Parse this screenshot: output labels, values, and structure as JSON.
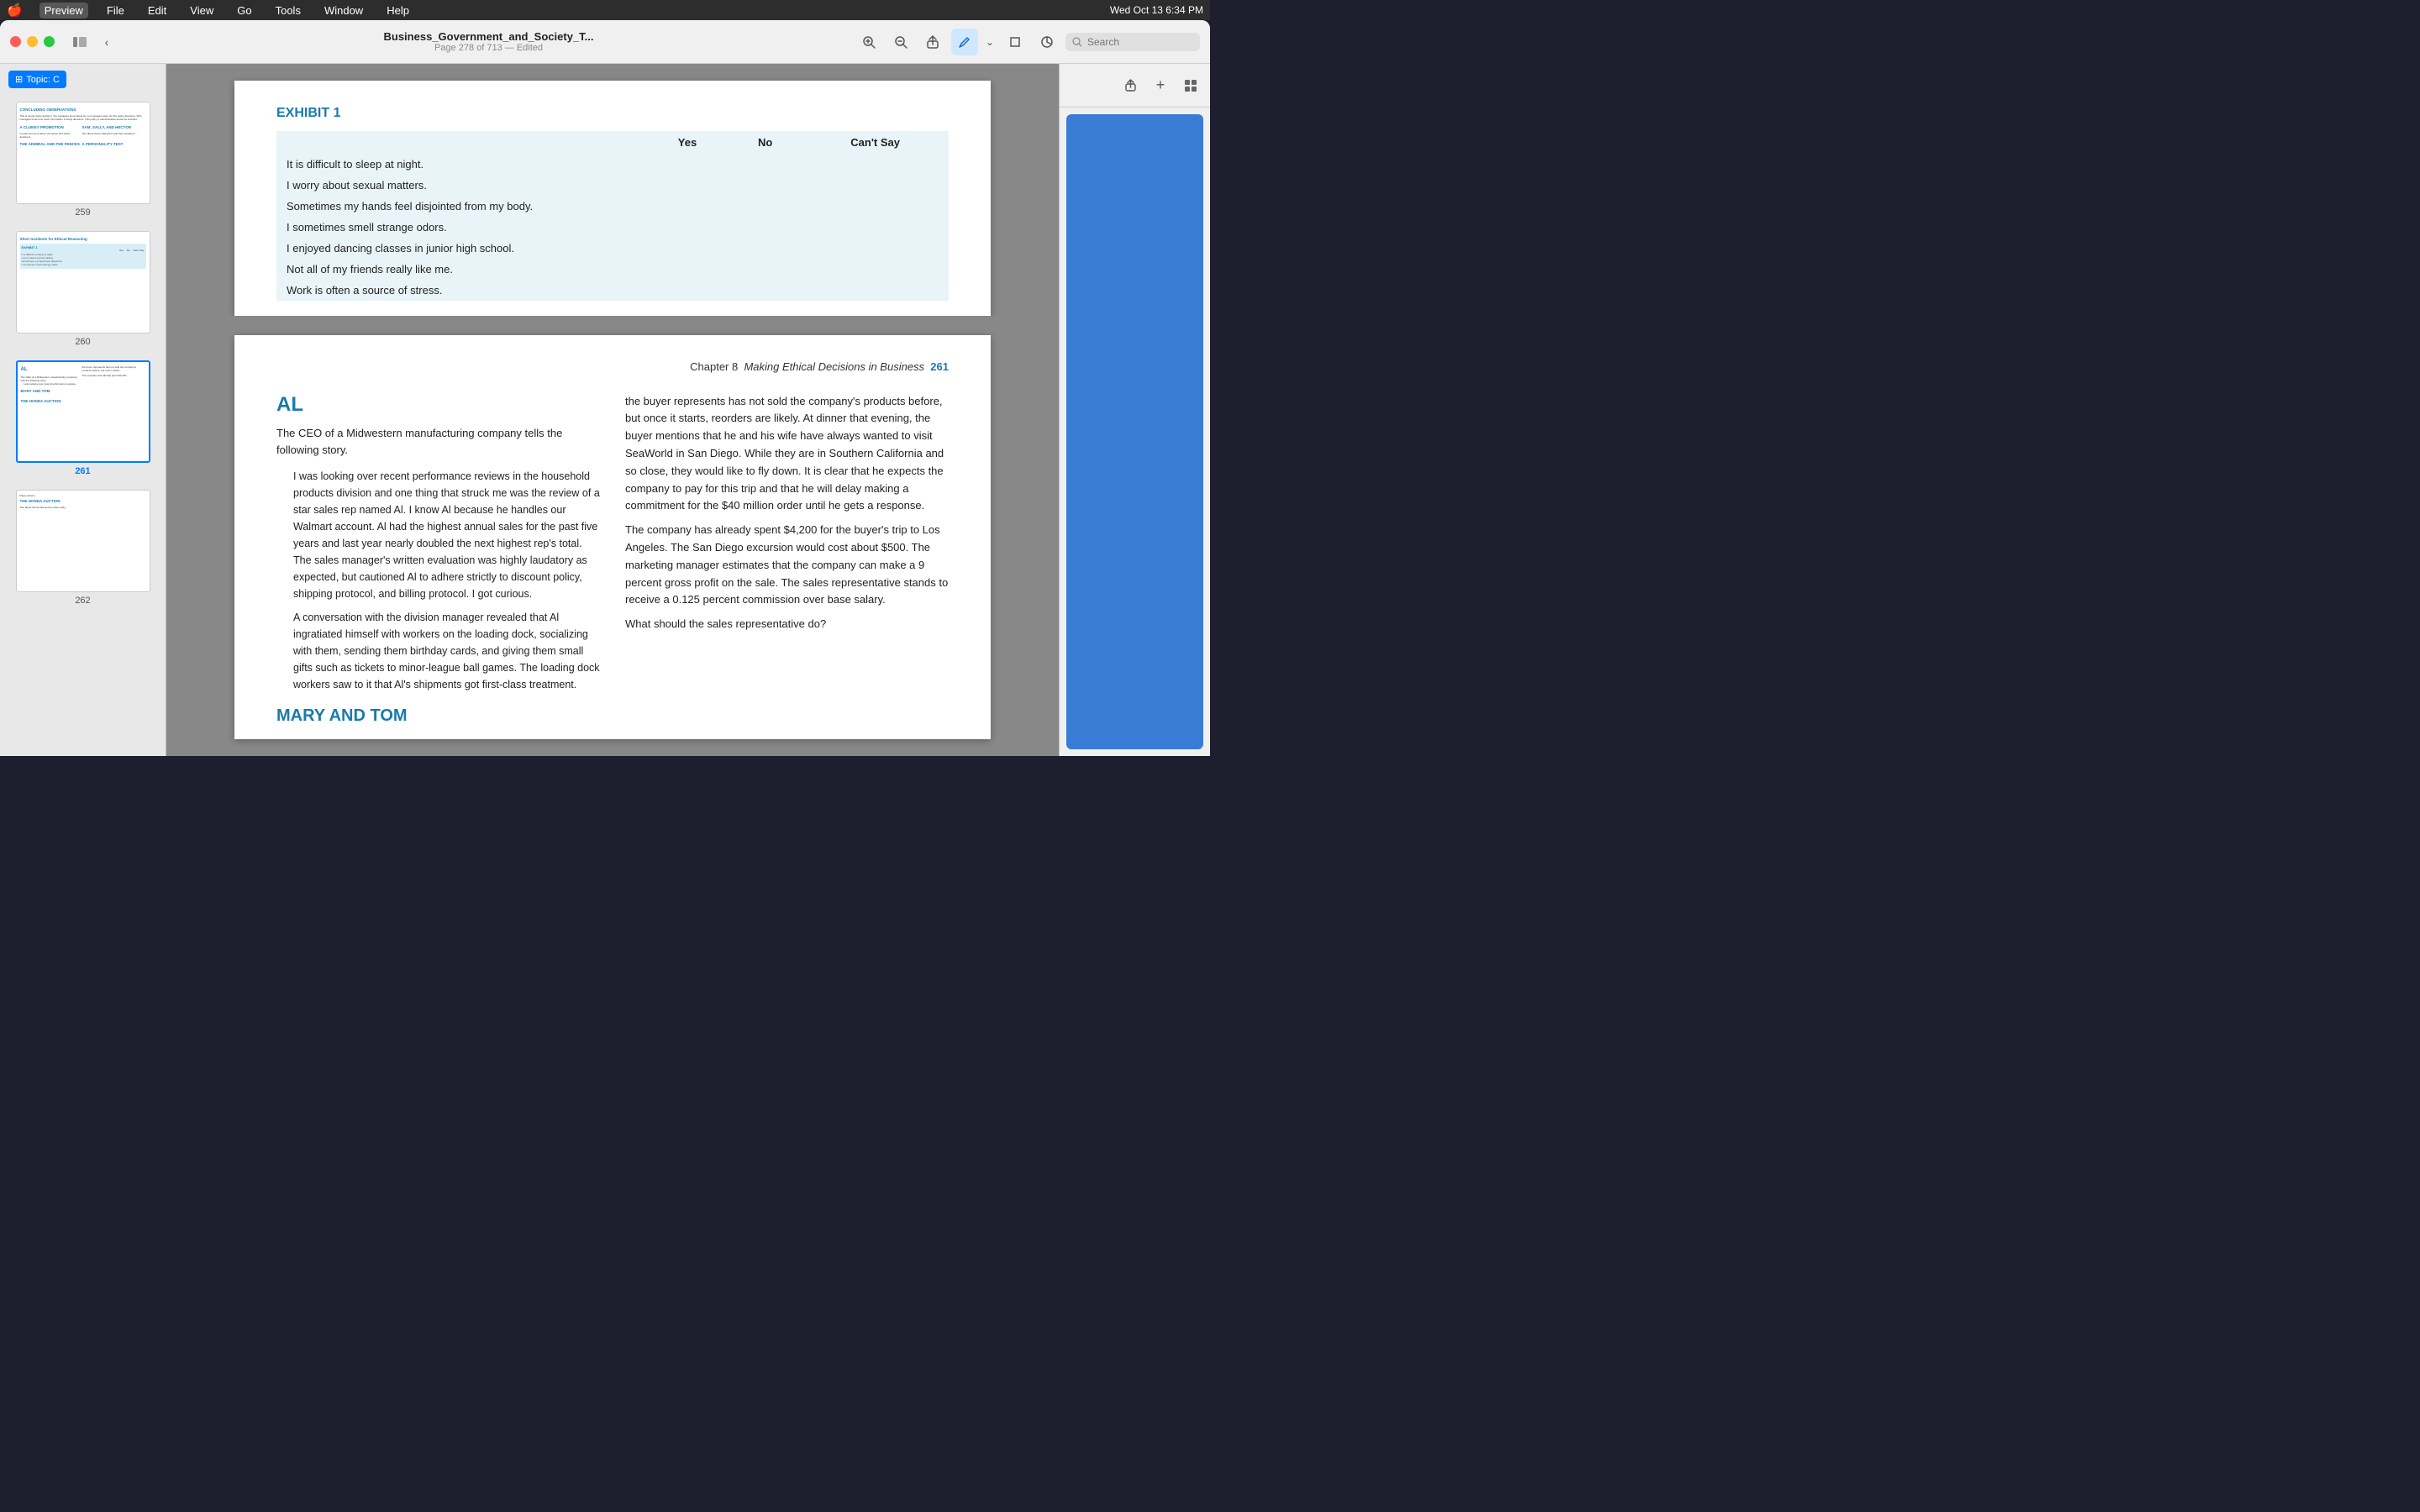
{
  "menubar": {
    "apple": "🍎",
    "app_name": "Preview",
    "menus": [
      "File",
      "Edit",
      "View",
      "Go",
      "Tools",
      "Window",
      "Help"
    ],
    "right": {
      "datetime": "Wed Oct 13  6:34 PM",
      "icons": [
        "wifi",
        "battery",
        "control-center"
      ]
    }
  },
  "window": {
    "title": "Business_Government_and_Society_T...",
    "subtitle": "Page 278 of 713 — Edited",
    "search_placeholder": "Search"
  },
  "sidebar": {
    "topic_label": "Topic: C",
    "pages": [
      {
        "num": "259",
        "selected": false
      },
      {
        "num": "260",
        "selected": false
      },
      {
        "num": "261",
        "selected": true
      },
      {
        "num": "262",
        "selected": false
      }
    ]
  },
  "page_top": {
    "exhibit_title": "EXHIBIT 1",
    "table_headers": [
      "",
      "Yes",
      "No",
      "Can't Say"
    ],
    "table_rows": [
      "It is difficult to sleep at night.",
      "I worry about sexual matters.",
      "Sometimes my hands feel disjointed from my body.",
      "I sometimes smell strange odors.",
      "I enjoyed dancing classes in junior high school.",
      "Not all of my friends really like me.",
      "Work is often a source of stress."
    ]
  },
  "page_bottom": {
    "chapter_label": "Chapter 8",
    "chapter_title": "Making Ethical Decisions in Business",
    "chapter_num": "261",
    "section_al": "AL",
    "intro_text": "The CEO of a Midwestern manufacturing company tells the following story.",
    "blockquote": "I was looking over recent performance reviews in the household products division and one thing that struck me was the review of a star sales rep named Al. I know Al because he handles our Walmart account. Al had the highest annual sales for the past five years and last year nearly doubled the next highest rep's total. The sales manager's written evaluation was highly laudatory as expected, but cautioned Al to adhere strictly to discount policy, shipping protocol, and billing protocol. I got curious.\n      A conversation with the division manager revealed that Al ingratiated himself with workers on the loading dock, socializing with them, sending them birthday cards, and giving them small gifts such as tickets to minor-league ball games. The loading dock workers saw to it that Al's shipments got first-class treatment.",
    "right_col_text": "the buyer represents has not sold the company's products before, but once it starts, reorders are likely. At dinner that evening, the buyer mentions that he and his wife have always wanted to visit SeaWorld in San Diego. While they are in Southern California and so close, they would like to fly down. It is clear that he expects the company to pay for this trip and that he will delay making a commitment for the $40 million order until he gets a response.\n      The company has already spent $4,200 for the buyer's trip to Los Angeles. The San Diego excursion would cost about $500. The marketing manager estimates that the company can make a 9 percent gross profit on the sale. The sales representative stands to receive a 0.125 percent commission over base salary.\n      What should the sales representative do?",
    "mary_tom_title": "MARY AND TOM"
  }
}
